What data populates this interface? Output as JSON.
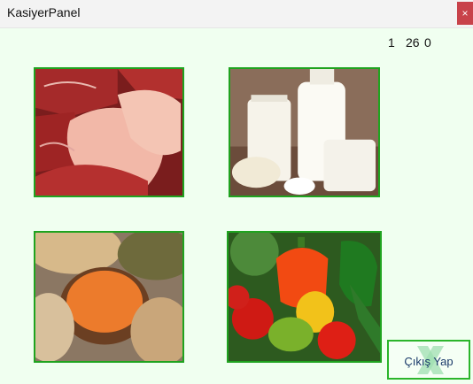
{
  "window": {
    "title": "KasiyerPanel",
    "close_glyph": "×"
  },
  "counters": [
    "1",
    "26",
    "0"
  ],
  "tiles": [
    {
      "name": "meat",
      "icon": "meat-products-image"
    },
    {
      "name": "dairy",
      "icon": "dairy-products-image"
    },
    {
      "name": "legumes",
      "icon": "legumes-grains-image"
    },
    {
      "name": "vegetables",
      "icon": "vegetables-image"
    }
  ],
  "exit_button": {
    "label": "Çıkış Yap",
    "icon": "exit-x-icon"
  },
  "colors": {
    "background": "#f0fff0",
    "tile_border": "#1fa31f",
    "close": "#c8424a"
  }
}
